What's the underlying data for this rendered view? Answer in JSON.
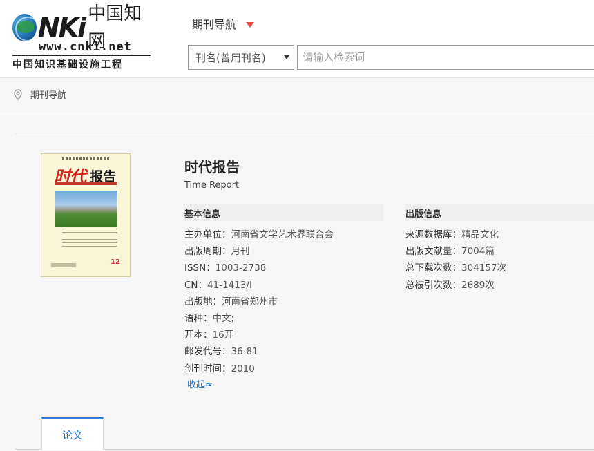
{
  "header": {
    "logo": {
      "brand_nki": "NKi",
      "brand_cn": "中国知网",
      "url": "www.cnki.net",
      "tagline": "中国知识基础设施工程"
    },
    "nav_dropdown_label": "期刊导航",
    "search": {
      "field_selected": "刊名(曾用刊名)",
      "placeholder": "请输入检索词",
      "value": ""
    }
  },
  "breadcrumb": {
    "icon": "location-pin-icon",
    "label": "期刊导航"
  },
  "journal": {
    "cover": {
      "title_part1": "时代",
      "title_part2": "报告",
      "issue": "12"
    },
    "title": "时代报告",
    "english_title": "Time Report",
    "basic_info": {
      "heading": "基本信息",
      "items": [
        {
          "label": "主办单位：",
          "value": "河南省文学艺术界联合会"
        },
        {
          "label": "出版周期：",
          "value": "月刊"
        },
        {
          "label": "ISSN：",
          "value": "1003-2738"
        },
        {
          "label": "CN：",
          "value": "41-1413/I"
        },
        {
          "label": "出版地：",
          "value": "河南省郑州市"
        },
        {
          "label": "语种：",
          "value": "中文;"
        },
        {
          "label": "开本：",
          "value": "16开"
        },
        {
          "label": "邮发代号：",
          "value": "36-81"
        },
        {
          "label": "创刊时间：",
          "value": "2010"
        }
      ],
      "collapse_label": "收起≈"
    },
    "publish_info": {
      "heading": "出版信息",
      "items": [
        {
          "label": "来源数据库：",
          "value": "精品文化"
        },
        {
          "label": "出版文献量：",
          "value": "7004篇"
        },
        {
          "label": "总下载次数：",
          "value": "304157次"
        },
        {
          "label": "总被引次数：",
          "value": "2689次"
        }
      ]
    }
  },
  "tabs": [
    {
      "label": "论文",
      "active": true
    }
  ],
  "colors": {
    "accent_blue": "#2d7ad6",
    "caret_red": "#e0473f",
    "link_blue": "#1f6fc5"
  }
}
